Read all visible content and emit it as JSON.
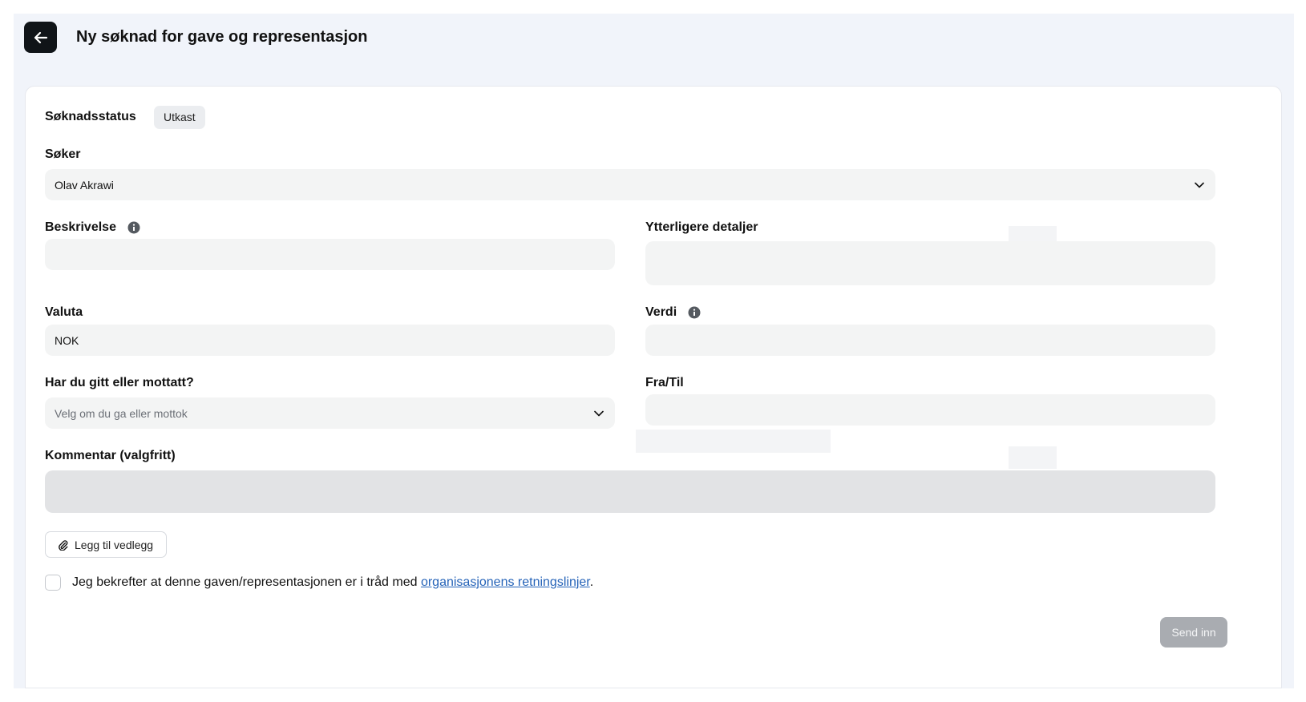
{
  "header": {
    "title": "Ny søknad for gave og representasjon",
    "back_icon": "arrow-left-icon"
  },
  "status": {
    "label": "Søknadsstatus",
    "badge": "Utkast"
  },
  "fields": {
    "applicant": {
      "label": "Søker",
      "value": "Olav Akrawi"
    },
    "description": {
      "label": "Beskrivelse",
      "value": ""
    },
    "details": {
      "label": "Ytterligere detaljer",
      "value": ""
    },
    "currency": {
      "label": "Valuta",
      "value": "NOK"
    },
    "amount": {
      "label": "Verdi",
      "value": ""
    },
    "given_received": {
      "label": "Har du gitt eller mottatt?",
      "placeholder": "Velg om du ga eller mottok"
    },
    "from_to": {
      "label": "Fra/Til",
      "value": ""
    },
    "comment": {
      "label": "Kommentar (valgfritt)",
      "value": ""
    }
  },
  "attach": {
    "label": "Legg til vedlegg",
    "icon": "paperclip-icon"
  },
  "confirm": {
    "text_before": "Jeg bekrefter at denne gaven/representasjonen er i tråd med ",
    "link_text": "organisasjonens retningslinjer",
    "text_after": "."
  },
  "submit": {
    "label": "Send inn"
  },
  "colors": {
    "page_bg": "#f1f4fa",
    "card_bg": "#ffffff",
    "input_bg": "#f3f4f4",
    "link": "#2563b8",
    "disabled_button": "#a9acb1",
    "back_button": "#101418"
  }
}
